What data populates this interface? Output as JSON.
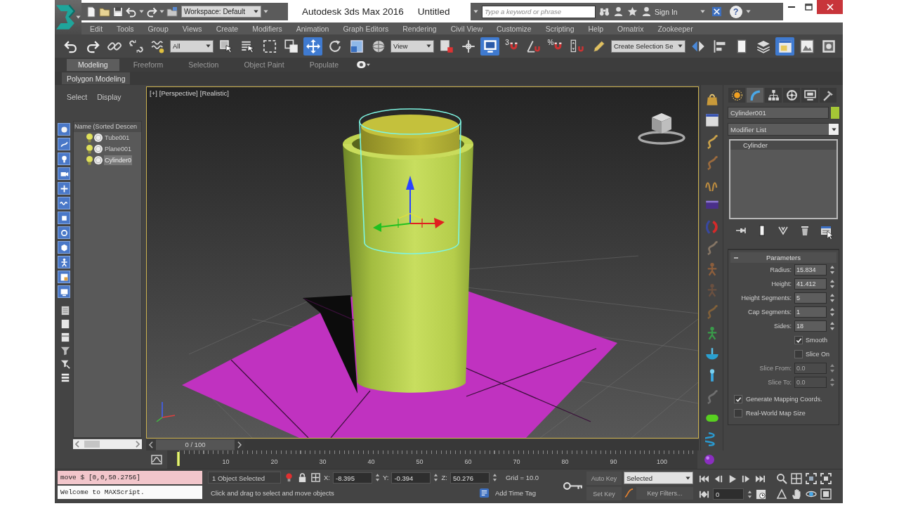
{
  "title_bar": {
    "workspace": "Workspace: Default",
    "app_name": "Autodesk 3ds Max 2016",
    "document": "Untitled",
    "search_placeholder": "Type a keyword or phrase",
    "sign_in": "Sign In",
    "help": "?"
  },
  "menu_bar": [
    "Edit",
    "Tools",
    "Group",
    "Views",
    "Create",
    "Modifiers",
    "Animation",
    "Graph Editors",
    "Rendering",
    "Civil View",
    "Customize",
    "Scripting",
    "Help",
    "Ornatrix",
    "Zookeeper"
  ],
  "main_toolbar": [
    {
      "kind": "button",
      "selected": false
    },
    {
      "kind": "button",
      "selected": false
    },
    {
      "kind": "button",
      "selected": false
    },
    {
      "kind": "button",
      "selected": false
    },
    {
      "kind": "button",
      "selected": false
    },
    {
      "kind": "dropdown",
      "value": "All"
    },
    {
      "kind": "button",
      "selected": false
    },
    {
      "kind": "button",
      "selected": false
    },
    {
      "kind": "button",
      "selected": false
    },
    {
      "kind": "button",
      "selected": false
    },
    {
      "kind": "button",
      "selected": true
    },
    {
      "kind": "button",
      "selected": false
    },
    {
      "kind": "button",
      "selected": false
    },
    {
      "kind": "button",
      "selected": false
    },
    {
      "kind": "dropdown",
      "value": "View"
    },
    {
      "kind": "button",
      "selected": false
    },
    {
      "kind": "button",
      "selected": false
    },
    {
      "kind": "button",
      "selected": true
    },
    {
      "kind": "snap",
      "label": "3",
      "selected": false
    },
    {
      "kind": "button",
      "selected": false
    },
    {
      "kind": "snap",
      "label": "%",
      "selected": false
    },
    {
      "kind": "button",
      "selected": false
    },
    {
      "kind": "button",
      "selected": false
    },
    {
      "kind": "dropdown",
      "value": "Create Selection Se"
    },
    {
      "kind": "button",
      "selected": false
    },
    {
      "kind": "button",
      "selected": false
    },
    {
      "kind": "button",
      "selected": false
    },
    {
      "kind": "button",
      "selected": false
    },
    {
      "kind": "button",
      "selected": true
    },
    {
      "kind": "button",
      "selected": false
    },
    {
      "kind": "button",
      "selected": false
    }
  ],
  "ribbon": {
    "tabs": [
      {
        "label": "Modeling",
        "selected": true
      },
      {
        "label": "Freeform",
        "selected": false
      },
      {
        "label": "Selection",
        "selected": false
      },
      {
        "label": "Object Paint",
        "selected": false
      },
      {
        "label": "Populate",
        "selected": false
      }
    ],
    "panel": "Polygon Modeling"
  },
  "scene_explorer": {
    "menu": [
      "Select",
      "Display"
    ],
    "filters": [
      {
        "on": true
      },
      {
        "on": true
      },
      {
        "on": true
      },
      {
        "on": true
      },
      {
        "on": true
      },
      {
        "on": true
      },
      {
        "on": true
      },
      {
        "on": true
      },
      {
        "on": true
      },
      {
        "on": true
      },
      {
        "on": true
      },
      {
        "on": true
      }
    ],
    "column": "Name (Sorted Descen",
    "items": [
      {
        "name": "Tube001",
        "selected": false
      },
      {
        "name": "Plane001",
        "selected": false
      },
      {
        "name": "Cylinder0",
        "selected": true
      }
    ]
  },
  "viewport": {
    "labels": [
      "[+]",
      "[Perspective]",
      "[Realistic]"
    ]
  },
  "command_panel": {
    "tabs": [
      {
        "selected": false
      },
      {
        "selected": true
      },
      {
        "selected": false
      },
      {
        "selected": false
      },
      {
        "selected": false
      },
      {
        "selected": false
      }
    ],
    "object_name": "Cylinder001",
    "modifier_list": "Modifier List",
    "stack": [
      {
        "name": "Cylinder",
        "selected": true
      }
    ],
    "rollout": {
      "title": "Parameters",
      "params": [
        {
          "kind": "spinner",
          "label": "Radius:",
          "value": "15.834",
          "disabled": false
        },
        {
          "kind": "spinner",
          "label": "Height:",
          "value": "41.412",
          "disabled": false
        },
        {
          "kind": "spinner",
          "label": "Height Segments:",
          "value": "5",
          "disabled": false
        },
        {
          "kind": "spinner",
          "label": "Cap Segments:",
          "value": "1",
          "disabled": false
        },
        {
          "kind": "spinner",
          "label": "Sides:",
          "value": "18",
          "disabled": false
        },
        {
          "kind": "checkbox",
          "label": "Smooth",
          "checked": true
        },
        {
          "kind": "checkbox",
          "label": "Slice On",
          "checked": false
        },
        {
          "kind": "spinner",
          "label": "Slice From:",
          "value": "0.0",
          "disabled": true
        },
        {
          "kind": "spinner",
          "label": "Slice To:",
          "value": "0.0",
          "disabled": true
        }
      ],
      "options": [
        {
          "label": "Generate Mapping Coords.",
          "checked": true
        },
        {
          "label": "Real-World Map Size",
          "checked": false
        }
      ]
    }
  },
  "time_slider": {
    "label": "0 / 100",
    "level": 0
  },
  "track_bar": {
    "labels": [
      "10",
      "20",
      "30",
      "40",
      "50",
      "60",
      "70",
      "80",
      "90",
      "100"
    ]
  },
  "status_bar": {
    "script_output": "move $ [0,0,50.2756]",
    "script_result": "Welcome to MAXScript.",
    "selection": "1 Object Selected",
    "prompt": "Click and drag to select and move objects",
    "coordinates": [
      {
        "axis": "X:",
        "value": "-8.395"
      },
      {
        "axis": "Y:",
        "value": "-0.394"
      },
      {
        "axis": "Z:",
        "value": "50.276"
      }
    ],
    "grid": "Grid = 10.0",
    "time_tag": "Add Time Tag",
    "auto_key": "Auto Key",
    "key_mode": "Selected",
    "set_key": "Set Key",
    "key_filters": "Key Filters...",
    "frame": "0"
  }
}
